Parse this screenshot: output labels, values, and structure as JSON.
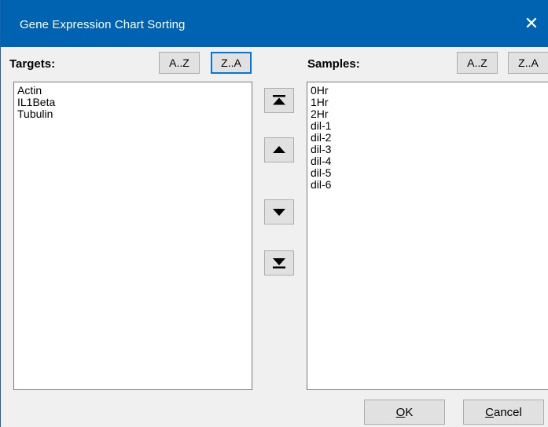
{
  "window": {
    "title": "Gene Expression Chart Sorting",
    "close_glyph": "✕"
  },
  "targets": {
    "label": "Targets:",
    "sort_asc": "A..Z",
    "sort_desc": "Z..A",
    "items": [
      "Actin",
      "IL1Beta",
      "Tubulin"
    ]
  },
  "samples": {
    "label": "Samples:",
    "sort_asc": "A..Z",
    "sort_desc": "Z..A",
    "items": [
      "0Hr",
      "1Hr",
      "2Hr",
      "dil-1",
      "dil-2",
      "dil-3",
      "dil-4",
      "dil-5",
      "dil-6"
    ]
  },
  "move_buttons": {
    "icons": [
      "move-to-top-icon",
      "move-up-icon",
      "move-down-icon",
      "move-to-bottom-icon"
    ]
  },
  "footer": {
    "ok_mnemonic": "O",
    "ok_rest": "K",
    "cancel_mnemonic": "C",
    "cancel_rest": "ancel"
  },
  "colors": {
    "titlebar": "#0063b1",
    "focus": "#0078d7"
  }
}
